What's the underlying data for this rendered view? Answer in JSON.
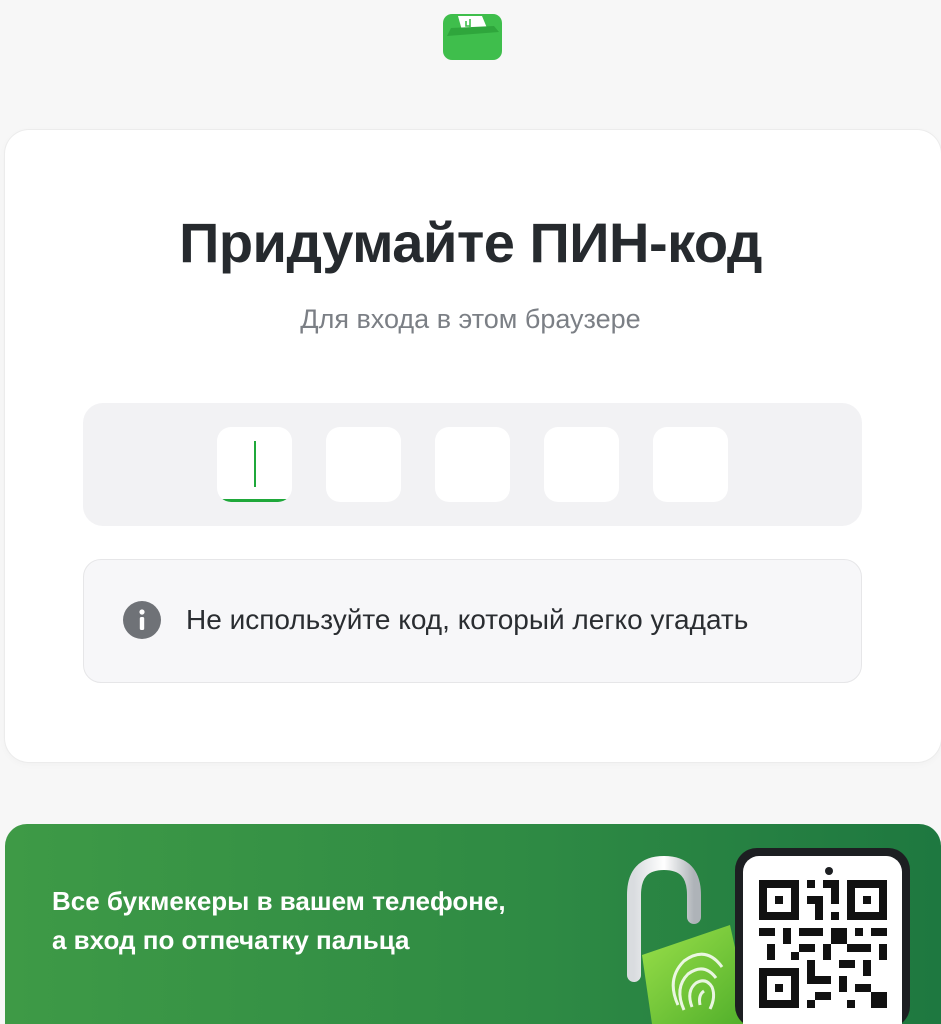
{
  "header": {
    "logo_icon": "wallet-logo-icon",
    "brand_color": "#3fbe4c"
  },
  "card": {
    "title": "Придумайте ПИН-код",
    "subtitle": "Для входа в этом браузере"
  },
  "pin": {
    "length": 5,
    "filled": 0,
    "active_index": 0,
    "accent_color": "#1fa83a"
  },
  "hint": {
    "icon": "info-icon",
    "text": "Не используйте код, который легко угадать"
  },
  "promo": {
    "line1": "Все букмекеры в вашем телефоне,",
    "line2": "а вход по отпечатку пальца",
    "lock_icon": "fingerprint-lock-icon",
    "qr_icon": "qr-code-icon",
    "background_color": "#2f8b44"
  }
}
